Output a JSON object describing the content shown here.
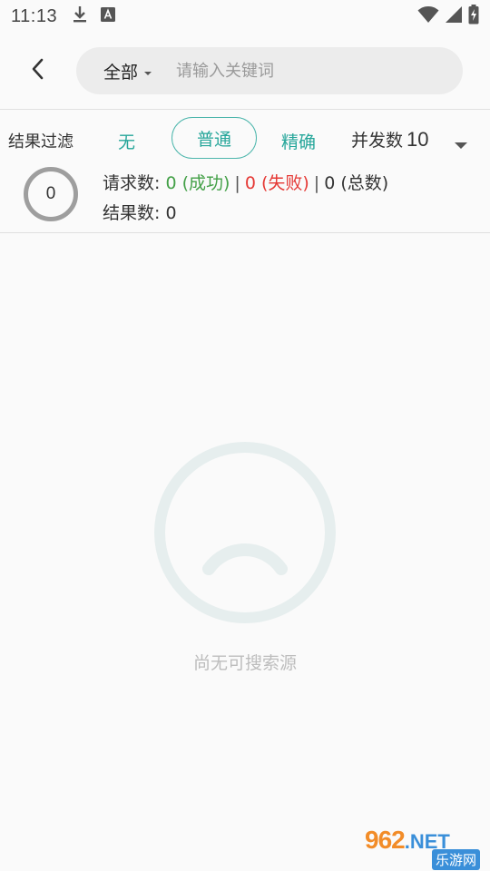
{
  "status_bar": {
    "time": "11:13",
    "left_icons": [
      "download-icon",
      "font-a-icon"
    ],
    "right_icons": [
      "wifi-icon",
      "signal-icon",
      "battery-charging-icon"
    ]
  },
  "header": {
    "back_icon": "chevron-left-icon",
    "scope_label": "全部",
    "search_value": "",
    "search_placeholder": "请输入关键词"
  },
  "filter": {
    "label": "结果过滤",
    "options": [
      {
        "label": "无",
        "selected": false
      },
      {
        "label": "普通",
        "selected": true
      },
      {
        "label": "精确",
        "selected": false
      }
    ],
    "concurrency_label": "并发数",
    "concurrency_value": "10"
  },
  "stats": {
    "progress_value": "0",
    "requests_label": "请求数:",
    "success_text": "0 (成功)",
    "fail_text": "0 (失败)",
    "total_text": "0 (总数)",
    "separator": "|",
    "results_label": "结果数:",
    "results_value": "0"
  },
  "empty_state": {
    "icon": "sad-face-icon",
    "message": "尚无可搜索源"
  },
  "watermark": {
    "brand_number": "962",
    "brand_suffix": ".NET",
    "brand_cn": "乐游网"
  },
  "colors": {
    "accent": "#26a69a",
    "success": "#43a047",
    "failure": "#e53935",
    "empty_icon": "#e6eeee"
  }
}
